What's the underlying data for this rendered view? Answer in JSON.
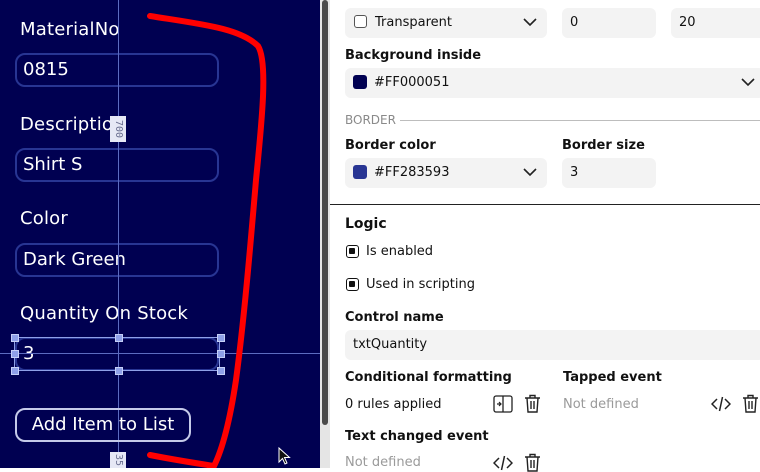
{
  "canvas": {
    "background": "#000051",
    "fields": [
      {
        "label": "MaterialNo",
        "value": "0815"
      },
      {
        "label": "Description",
        "value": "Shirt S"
      },
      {
        "label": "Color",
        "value": "Dark Green"
      },
      {
        "label": "Quantity On Stock",
        "value": "3"
      }
    ],
    "button_label": "Add Item to List",
    "ruler_top": "700",
    "ruler_bottom": "35"
  },
  "panel": {
    "background_outside": {
      "value": "Transparent"
    },
    "spin1": "0",
    "spin2": "20",
    "background_inside": {
      "label": "Background inside",
      "value": "#FF000051",
      "color": "#000051"
    },
    "border_section": "BORDER",
    "border_color": {
      "label": "Border color",
      "value": "#FF283593",
      "color": "#283593"
    },
    "border_size": {
      "label": "Border size",
      "value": "3"
    },
    "logic": {
      "title": "Logic",
      "is_enabled": "Is enabled",
      "used_in_scripting": "Used in scripting",
      "control_name_label": "Control name",
      "control_name_value": "txtQuantity",
      "conditional_formatting_label": "Conditional formatting",
      "conditional_formatting_value": "0 rules applied",
      "tapped_event_label": "Tapped event",
      "tapped_event_value": "Not defined",
      "text_changed_label": "Text changed event",
      "text_changed_value": "Not defined"
    }
  },
  "icons": {
    "chevron": "chevron-down-icon",
    "code": "code-icon",
    "trash": "trash-icon",
    "format": "format-rules-icon"
  }
}
